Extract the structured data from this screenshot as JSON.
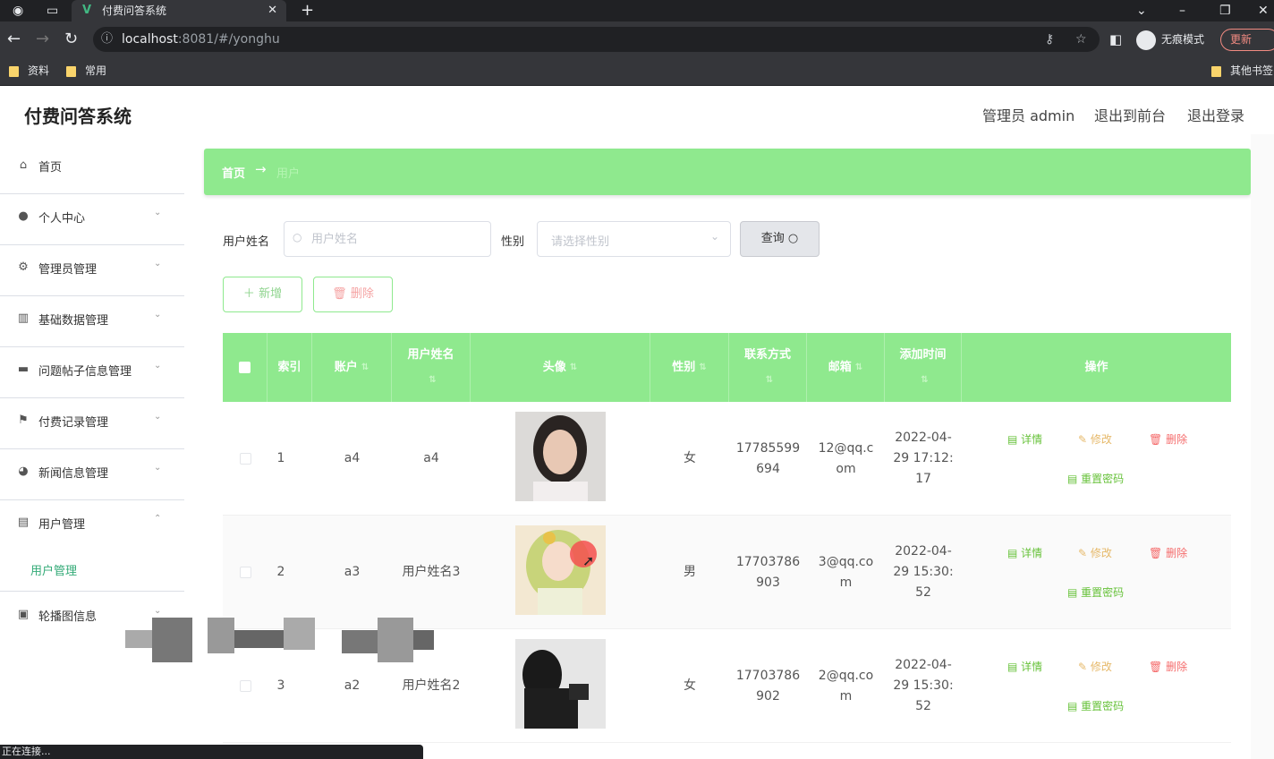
{
  "browser": {
    "tab_title": "付费问答系统",
    "url_host": "localhost",
    "url_rest": ":8081/#/yonghu",
    "incognito_label": "无痕模式",
    "update_label": "更新",
    "bookmarks": [
      "资料",
      "常用"
    ],
    "other_bookmarks": "其他书签",
    "status_text": "正在连接..."
  },
  "header": {
    "title": "付费问答系统",
    "admin": "管理员 admin",
    "to_front": "退出到前台",
    "logout": "退出登录"
  },
  "sidebar": {
    "items": [
      {
        "label": "首页",
        "icon": "home-icon",
        "chevron": ""
      },
      {
        "label": "个人中心",
        "icon": "user-icon",
        "chevron": "⌄"
      },
      {
        "label": "管理员管理",
        "icon": "gear-icon",
        "chevron": "⌄"
      },
      {
        "label": "基础数据管理",
        "icon": "books-icon",
        "chevron": "⌄"
      },
      {
        "label": "问题帖子信息管理",
        "icon": "monitor-icon",
        "chevron": "⌄"
      },
      {
        "label": "付费记录管理",
        "icon": "flag-icon",
        "chevron": "⌄"
      },
      {
        "label": "新闻信息管理",
        "icon": "globe-icon",
        "chevron": "⌄"
      },
      {
        "label": "用户管理",
        "icon": "clipboard-icon",
        "chevron": "⌃"
      },
      {
        "label": "轮播图信息",
        "icon": "carousel-icon",
        "chevron": "⌄"
      }
    ],
    "subitem": "用户管理"
  },
  "breadcrumb": {
    "home": "首页",
    "arrow": "→",
    "current": "用户"
  },
  "search": {
    "name_label": "用户姓名",
    "name_placeholder": "用户姓名",
    "sex_label": "性别",
    "sex_placeholder": "请选择性别",
    "query_label": "查询"
  },
  "toolbar": {
    "add_label": "新增",
    "delete_label": "删除"
  },
  "table": {
    "columns": [
      "索引",
      "账户",
      "用户姓名",
      "头像",
      "性别",
      "联系方式",
      "邮箱",
      "添加时间",
      "操作"
    ],
    "rows": [
      {
        "index": "1",
        "account": "a4",
        "name": "a4",
        "sex": "女",
        "phone": [
          "17785599",
          "694"
        ],
        "email": [
          "12@qq.c",
          "om"
        ],
        "time": [
          "2022-04-",
          "29 17:12:",
          "17"
        ]
      },
      {
        "index": "2",
        "account": "a3",
        "name": "用户姓名3",
        "sex": "男",
        "phone": [
          "17703786",
          "903"
        ],
        "email": [
          "3@qq.co",
          "m"
        ],
        "time": [
          "2022-04-",
          "29 15:30:",
          "52"
        ]
      },
      {
        "index": "3",
        "account": "a2",
        "name": "用户姓名2",
        "sex": "女",
        "phone": [
          "17703786",
          "902"
        ],
        "email": [
          "2@qq.co",
          "m"
        ],
        "time": [
          "2022-04-",
          "29 15:30:",
          "52"
        ]
      }
    ],
    "actions": {
      "detail": "详情",
      "edit": "修改",
      "delete": "删除",
      "reset": "重置密码"
    }
  },
  "colors": {
    "accent": "#8fe98e",
    "danger": "#f56c6c",
    "warning": "#e6b96a",
    "success": "#67c23a"
  }
}
